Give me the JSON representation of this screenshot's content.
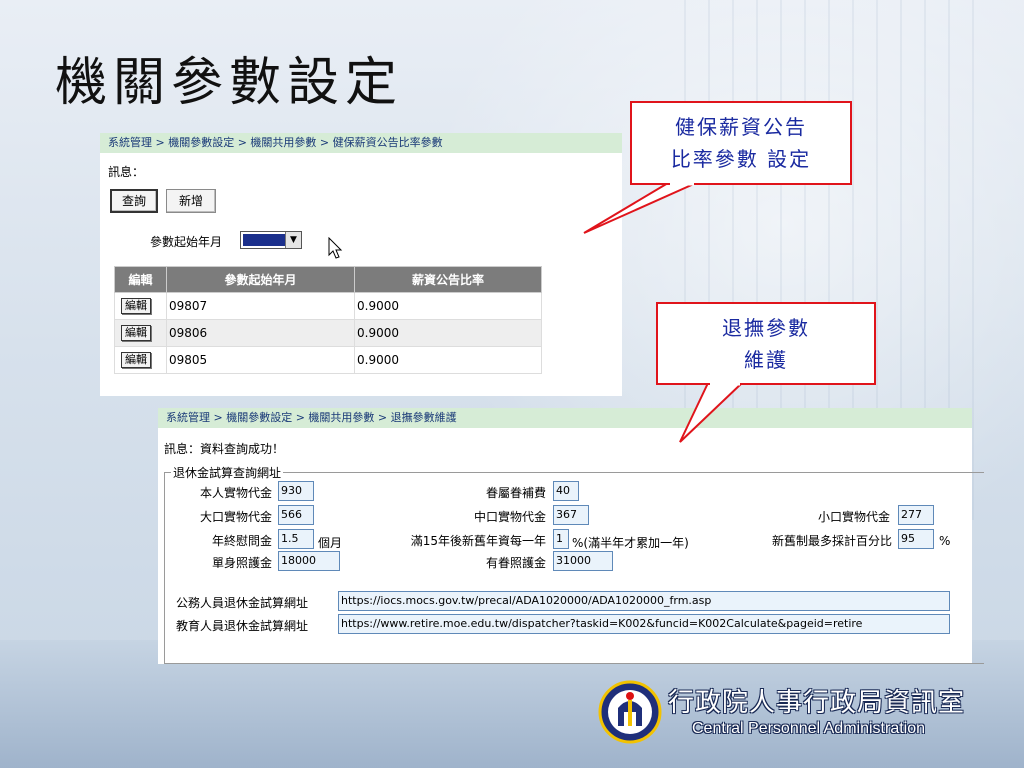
{
  "slide": {
    "title": "機關參數設定"
  },
  "panel1": {
    "breadcrumb": "系統管理 > 機關參數設定 > 機關共用參數 > 健保薪資公告比率參數",
    "message_label": "訊息：",
    "buttons": {
      "query": "查詢",
      "add": "新增"
    },
    "start_month_label": "參數起始年月",
    "start_month_value": "",
    "table": {
      "headers": [
        "編輯",
        "參數起始年月",
        "薪資公告比率"
      ],
      "edit_label": "編輯",
      "rows": [
        {
          "month": "09807",
          "ratio": "0.9000"
        },
        {
          "month": "09806",
          "ratio": "0.9000"
        },
        {
          "month": "09805",
          "ratio": "0.9000"
        }
      ]
    }
  },
  "panel2": {
    "breadcrumb": "系統管理 > 機關參數設定 > 機關共用參數 > 退撫參數維護",
    "message": "訊息：資料查詢成功！",
    "legend": "退休金試算查詢網址",
    "fields": {
      "self_meal_label": "本人實物代金",
      "self_meal_value": "930",
      "dependent_label": "眷屬眷補費",
      "dependent_value": "40",
      "small_meal_label": "小口實物代金",
      "small_meal_value": "277",
      "large_meal_label": "大口實物代金",
      "large_meal_value": "566",
      "mid_meal_label": "中口實物代金",
      "mid_meal_value": "367",
      "year_end_label": "年終慰問金",
      "year_end_value": "1.5",
      "year_end_unit": "個月",
      "after15_label": "滿15年後新舊年資每一年",
      "after15_value": "1",
      "after15_unit": "%(滿半年才累加一年)",
      "max_pct_label": "新舊制最多採計百分比",
      "max_pct_value": "95",
      "max_pct_unit": "%",
      "single_care_label": "單身照護金",
      "single_care_value": "18000",
      "dependent_care_label": "有眷照護金",
      "dependent_care_value": "31000"
    },
    "urls": {
      "civil_label": "公務人員退休金試算網址",
      "civil_value": "https://iocs.mocs.gov.tw/precal/ADA1020000/ADA1020000_frm.asp",
      "edu_label": "教育人員退休金試算網址",
      "edu_value": "https://www.retire.moe.edu.tw/dispatcher?taskid=K002&funcid=K002Calculate&pageid=retire"
    }
  },
  "callouts": {
    "health_line1": "健保薪資公告",
    "health_line2": "比率參數 設定",
    "retire_line1": "退撫參數",
    "retire_line2": "維護",
    "border_color": "#e0141b",
    "text_color": "#1a2aa0"
  },
  "logo": {
    "chinese": "行政院人事行政局資訊室",
    "english": "Central Personnel Administration"
  }
}
